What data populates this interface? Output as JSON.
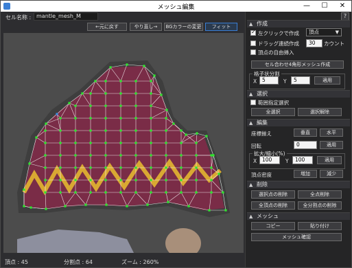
{
  "window": {
    "title": "メッシュ編集",
    "minimize": "—",
    "maximize": "☐",
    "close": "✕"
  },
  "toolbar": {
    "cell_label": "セル名称 :",
    "cell_name": "mantle_mesh_M",
    "undo_label": "←元に戻す",
    "redo_label": "やり直し→",
    "bgcolor_label": "BGカラーの変更",
    "fit_label": "フィット"
  },
  "status": {
    "vertices": "頂点 : 45",
    "divisions": "分割点 : 64",
    "zoom": "ズーム : 260%"
  },
  "panel": {
    "help": "?",
    "create": {
      "title": "作成",
      "left_click_create": "左クリックで作成",
      "left_click_checked": true,
      "mode_value": "頂点",
      "drag_create": "ドラッグ連続作成",
      "drag_count": "30",
      "count_label": "カウント",
      "free_insert": "頂点の自由挿入",
      "auto_mesh_button": "セル合わせ4角形メッシュ作成",
      "grid_split_title": "格子状分割",
      "x_label": "X",
      "x_value": "5",
      "y_label": "Y",
      "y_value": "5",
      "apply": "適用"
    },
    "select": {
      "title": "選択",
      "range_select": "範囲指定選択",
      "select_all": "全選択",
      "deselect": "選択解除"
    },
    "edit": {
      "title": "編集",
      "align_label": "座標揃え",
      "vertical": "垂直",
      "horizontal": "水平",
      "rotate_label": "回転",
      "rotate_value": "0",
      "apply": "適用",
      "scale_title": "拡大/縮小(%)",
      "x_label": "X",
      "x_value": "100",
      "y_label": "Y",
      "y_value": "100",
      "density_label": "頂点密度",
      "increase": "増加",
      "decrease": "減少"
    },
    "delete": {
      "title": "削除",
      "delete_selected": "選択点の削除",
      "delete_all": "全点削除",
      "delete_all_vertices": "全頂点の削除",
      "delete_all_divisions": "全分割点の削除"
    },
    "mesh": {
      "title": "メッシュ",
      "copy": "コピー",
      "paste": "貼り付け",
      "confirm": "メッシュ確認"
    }
  },
  "colors": {
    "vertex": "#2ee62e",
    "edge": "#ffffff",
    "selected_vertex": "#3a8fe0",
    "mantle_fill": "#7a2c47",
    "zigzag": "#d9a832"
  }
}
